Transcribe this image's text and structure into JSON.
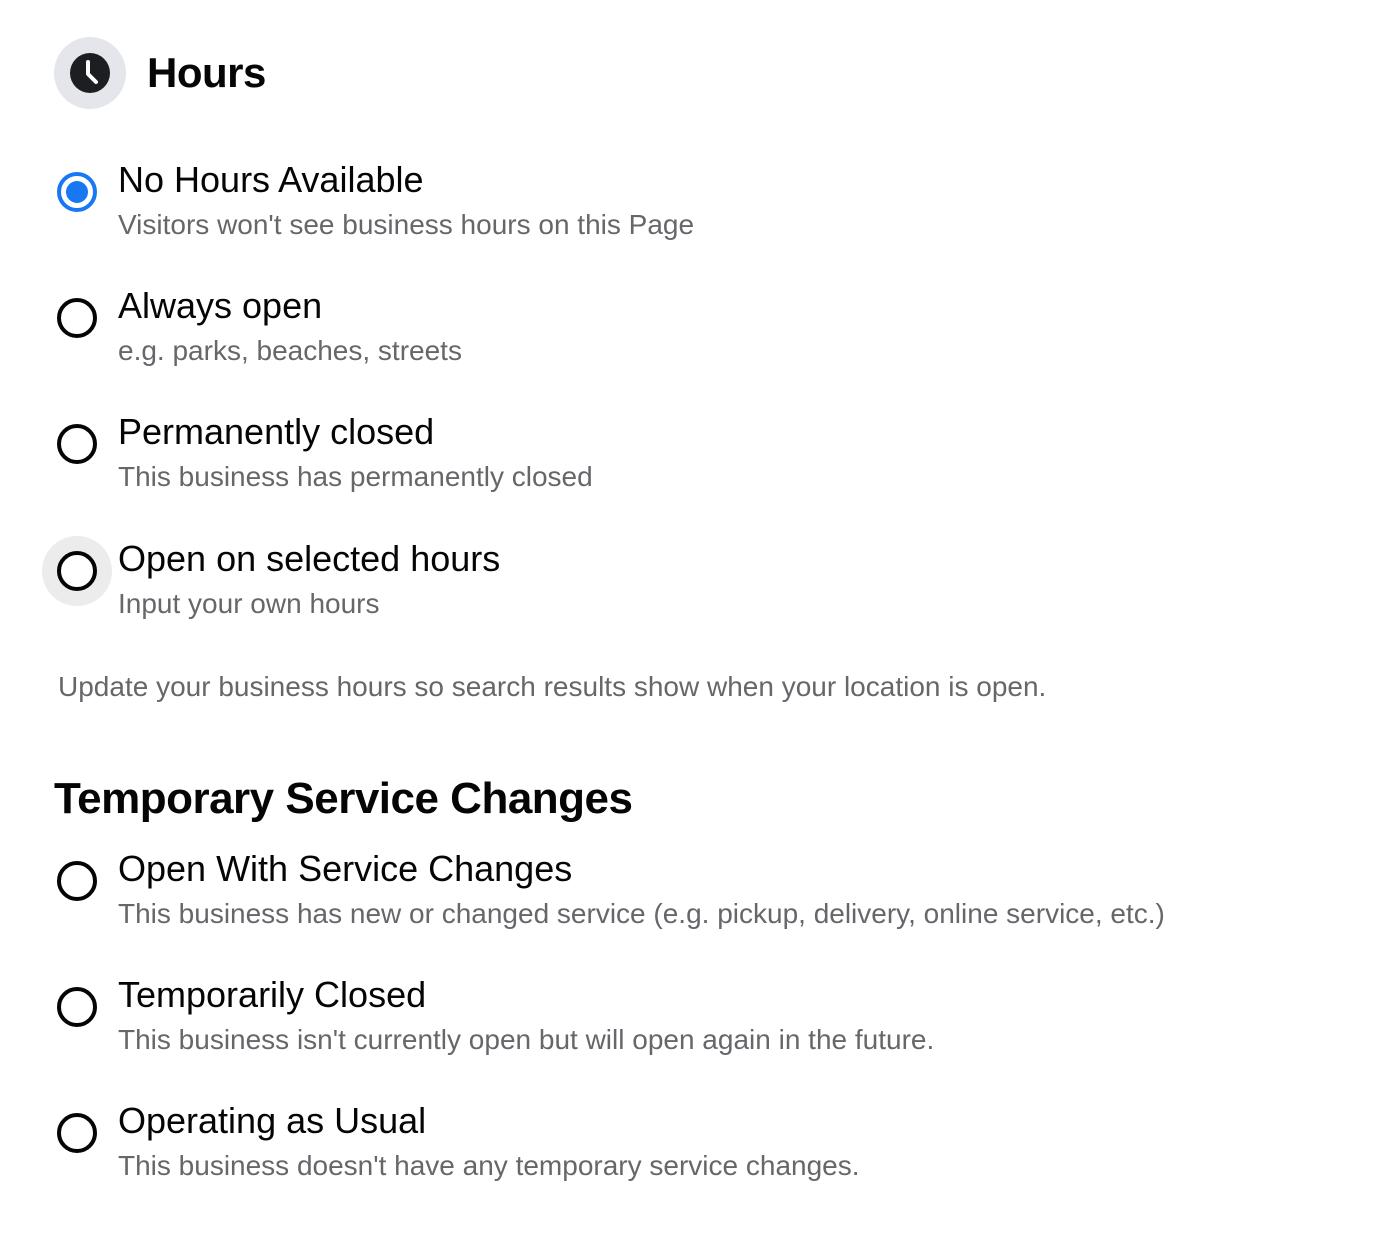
{
  "hours": {
    "title": "Hours",
    "icon": "clock-icon",
    "options": [
      {
        "label": "No Hours Available",
        "description": "Visitors won't see business hours on this Page",
        "checked": true
      },
      {
        "label": "Always open",
        "description": "e.g. parks, beaches, streets",
        "checked": false
      },
      {
        "label": "Permanently closed",
        "description": "This business has permanently closed",
        "checked": false
      },
      {
        "label": "Open on selected hours",
        "description": "Input your own hours",
        "checked": false
      }
    ],
    "help_text": "Update your business hours so search results show when your location is open."
  },
  "temporary": {
    "title": "Temporary Service Changes",
    "options": [
      {
        "label": "Open With Service Changes",
        "description": "This business has new or changed service (e.g. pickup, delivery, online service, etc.)",
        "checked": false
      },
      {
        "label": "Temporarily Closed",
        "description": "This business isn't currently open but will open again in the future.",
        "checked": false
      },
      {
        "label": "Operating as Usual",
        "description": "This business doesn't have any temporary service changes.",
        "checked": false
      }
    ]
  },
  "colors": {
    "accent": "#1877f2",
    "text_primary": "#050505",
    "text_secondary": "#65676b",
    "icon_background": "#e4e6eb"
  }
}
